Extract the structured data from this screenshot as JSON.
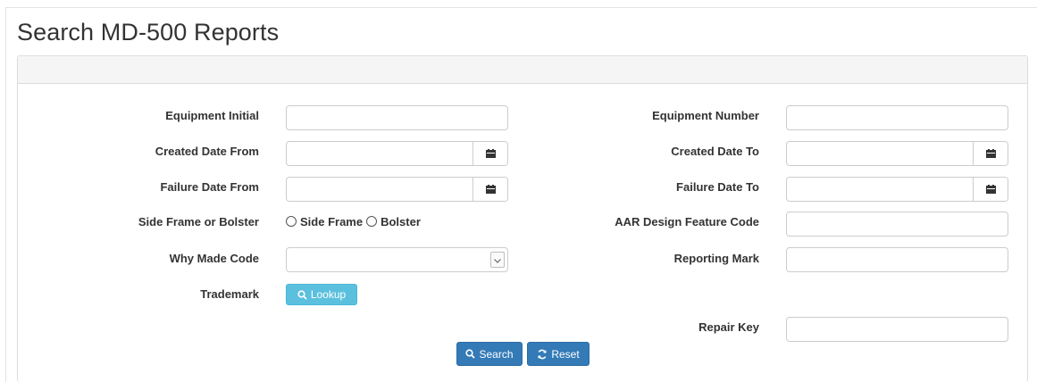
{
  "page": {
    "title": "Search MD-500 Reports"
  },
  "form": {
    "equipment_initial": {
      "label": "Equipment Initial",
      "value": "",
      "placeholder": ""
    },
    "equipment_number": {
      "label": "Equipment Number",
      "value": "",
      "placeholder": ""
    },
    "created_date_from": {
      "label": "Created Date From",
      "value": "",
      "icon": "calendar-icon"
    },
    "created_date_to": {
      "label": "Created Date To",
      "value": "",
      "icon": "calendar-icon"
    },
    "failure_date_from": {
      "label": "Failure Date From",
      "value": "",
      "icon": "calendar-icon"
    },
    "failure_date_to": {
      "label": "Failure Date To",
      "value": "",
      "icon": "calendar-icon"
    },
    "side_frame_or_bolster": {
      "label": "Side Frame or Bolster",
      "options": [
        "Side Frame",
        "Bolster"
      ],
      "selected": null
    },
    "aar_design_feature_code": {
      "label": "AAR Design Feature Code",
      "value": ""
    },
    "why_made_code": {
      "label": "Why Made Code",
      "selected": "",
      "icon": "chevron-down-icon"
    },
    "reporting_mark": {
      "label": "Reporting Mark",
      "value": ""
    },
    "trademark": {
      "label": "Trademark",
      "button_label": "Lookup",
      "icon": "search-icon"
    },
    "repair_key": {
      "label": "Repair Key",
      "value": ""
    }
  },
  "actions": {
    "search_label": "Search",
    "search_icon": "search-icon",
    "reset_label": "Reset",
    "reset_icon": "refresh-icon"
  },
  "colors": {
    "primary": "#337ab7",
    "info": "#5bc0de",
    "panel_heading": "#f5f5f5",
    "border": "#cccccc"
  }
}
